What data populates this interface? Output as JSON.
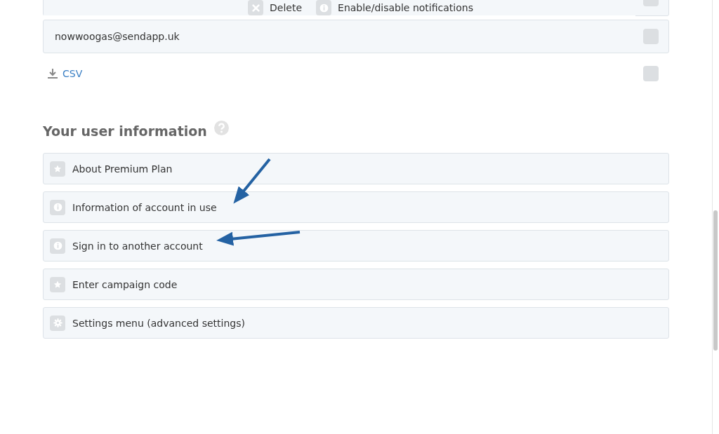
{
  "accounts": [
    {
      "checked": false
    },
    {
      "email": "nowwoogas@sendapp.uk",
      "checked": false
    }
  ],
  "toolbar": {
    "actions": [
      {
        "label": "Delete",
        "kind": "delete"
      },
      {
        "label": "Enable/disable notifications",
        "kind": "info"
      }
    ]
  },
  "export": {
    "label": "CSV",
    "checked": false
  },
  "user_info": {
    "title": "Your user information",
    "items": [
      {
        "label": "About Premium Plan",
        "kind": "star"
      },
      {
        "label": "Information of account in use",
        "kind": "info"
      },
      {
        "label": "Sign in to another account",
        "kind": "info"
      },
      {
        "label": "Enter campaign code",
        "kind": "star"
      },
      {
        "label": "Settings menu (advanced settings)",
        "kind": "gear"
      }
    ]
  }
}
